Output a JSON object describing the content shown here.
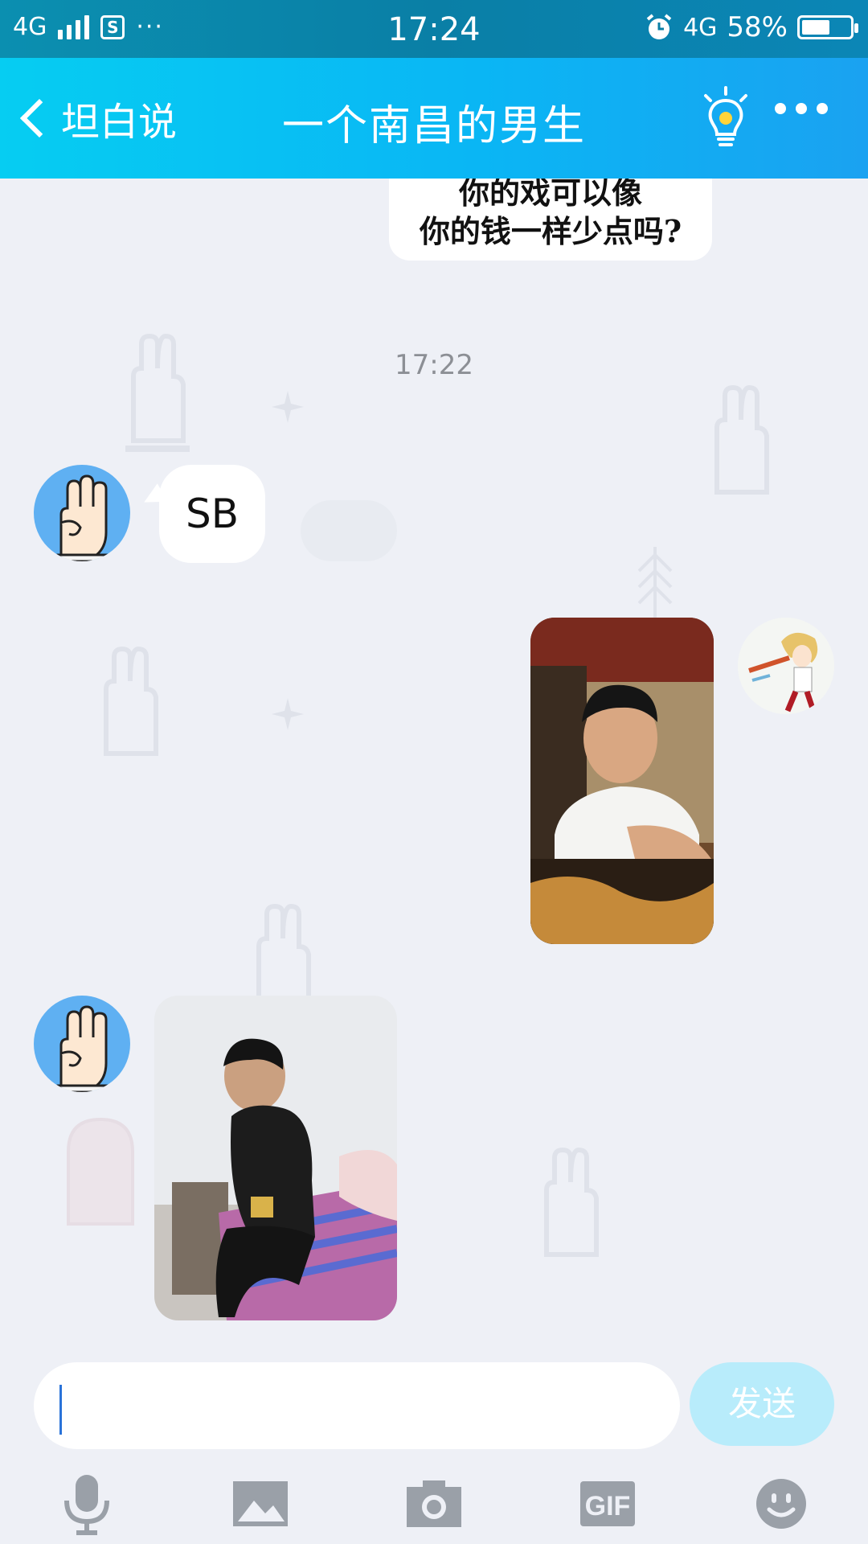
{
  "status_bar": {
    "network_left": "4G",
    "app_icon_letter": "S",
    "dots": "···",
    "time": "17:24",
    "network_right": "4G",
    "battery_percent": "58%",
    "battery_level": 0.58
  },
  "nav": {
    "back_label": "坦白说",
    "title": "一个南昌的男生"
  },
  "chat": {
    "top_bubble_line1": "你的戏可以像",
    "top_bubble_line2": "你的钱一样少点吗?",
    "timestamp": "17:22",
    "message_text": "SB"
  },
  "input": {
    "value": "",
    "placeholder": "",
    "send_label": "发送"
  },
  "toolbar": {
    "gif_label": "GIF",
    "icons": [
      "microphone-icon",
      "image-icon",
      "camera-icon",
      "gif-icon",
      "emoji-icon"
    ]
  },
  "colors": {
    "nav_start": "#06cdf2",
    "nav_end": "#1aa2f1",
    "avatar_blue": "#5fb0f2",
    "send_disabled": "#b8ecfb",
    "background": "#eef0f6"
  }
}
